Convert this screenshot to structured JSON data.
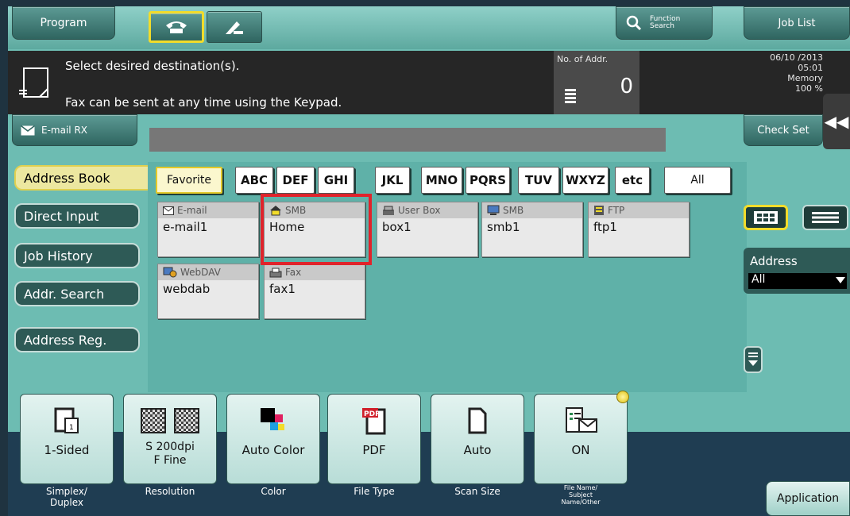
{
  "topbar": {
    "program_label": "Program",
    "function_search_label": [
      "Function",
      "Search"
    ],
    "job_list_label": "Job List"
  },
  "banner": {
    "message_1": "Select desired destination(s).",
    "message_2": "Fax can be sent at any time using the Keypad.",
    "addr_count_label": "No. of Addr.",
    "addr_count_value": "0",
    "date": "06/10 /2013",
    "time": "05:01",
    "memory_label": "Memory",
    "memory_value": "100 %"
  },
  "email_rx_label": "E-mail RX",
  "check_set_label": "Check Set",
  "left_tabs": [
    {
      "label": "Address Book",
      "active": true
    },
    {
      "label": "Direct Input",
      "active": false
    },
    {
      "label": "Job History",
      "active": false
    },
    {
      "label": "Addr. Search",
      "active": false
    },
    {
      "label": "Address Reg.",
      "active": false
    }
  ],
  "filters": [
    "Favorite",
    "ABC",
    "DEF",
    "GHI",
    "JKL",
    "MNO",
    "PQRS",
    "TUV",
    "WXYZ",
    "etc",
    "All"
  ],
  "destinations": [
    {
      "type": "E-mail",
      "name": "e-mail1",
      "icon": "envelope-icon"
    },
    {
      "type": "SMB",
      "name": "Home",
      "icon": "house-icon",
      "selected": true
    },
    {
      "type": "User Box",
      "name": "box1",
      "icon": "user-box-icon"
    },
    {
      "type": "SMB",
      "name": "smb1",
      "icon": "computer-icon"
    },
    {
      "type": "FTP",
      "name": "ftp1",
      "icon": "server-icon"
    },
    {
      "type": "WebDAV",
      "name": "webdab",
      "icon": "webdav-icon"
    },
    {
      "type": "Fax",
      "name": "fax1",
      "icon": "fax-icon"
    }
  ],
  "address_filter": {
    "label": "Address",
    "value": "All"
  },
  "settings": [
    {
      "value": "1-Sided",
      "caption": "Simplex/\nDuplex",
      "icon": "simplex-icon"
    },
    {
      "value": "S 200dpi\nF Fine",
      "caption": "Resolution",
      "icon": "resolution-icon"
    },
    {
      "value": "Auto Color",
      "caption": "Color",
      "icon": "color-icon"
    },
    {
      "value": "PDF",
      "caption": "File Type",
      "icon": "pdf-icon"
    },
    {
      "value": "Auto",
      "caption": "Scan Size",
      "icon": "page-icon"
    },
    {
      "value": "ON",
      "caption": "File Name/\nSubject\nName/Other",
      "icon": "file-name-icon"
    }
  ],
  "application_label": "Application",
  "colors": {
    "accent_yellow": "#f2dc2a",
    "selection_red": "#e0232b",
    "panel_teal": "#6dbcb2"
  }
}
